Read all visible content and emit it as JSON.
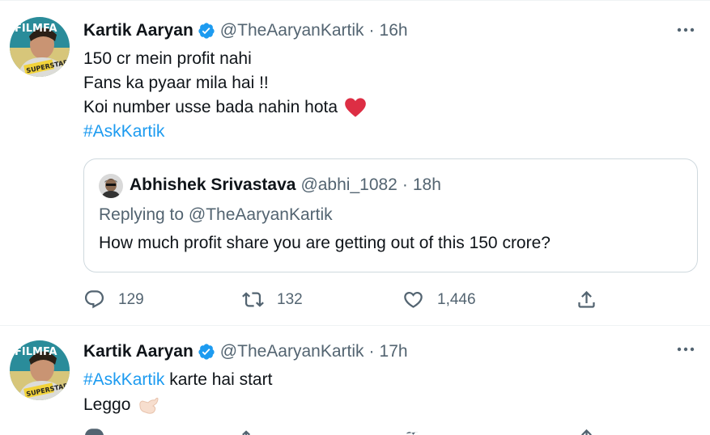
{
  "tweets": [
    {
      "name": "Kartik Aaryan",
      "handle": "@TheAaryanKartik",
      "time": "16h",
      "lines": [
        "150 cr mein profit nahi",
        "Fans ka pyaar mila hai !!",
        "Koi number usse bada nahin hota"
      ],
      "hashtag": "#AskKartik",
      "quote": {
        "name": "Abhishek Srivastava",
        "handle": "@abhi_1082",
        "time": "18h",
        "replying_label": "Replying to",
        "replying_to": "@TheAaryanKartik",
        "text": "How much profit share you are getting out of this 150 crore?"
      },
      "actions": {
        "replies": "129",
        "retweets": "132",
        "likes": "1,446"
      }
    },
    {
      "name": "Kartik Aaryan",
      "handle": "@TheAaryanKartik",
      "time": "17h",
      "hashtag": "#AskKartik",
      "line1_rest": " karte hai start",
      "line2": "Leggo"
    }
  ],
  "separator": "·",
  "icons": {
    "verified": "verified-badge-icon",
    "more": "more-options-icon",
    "reply": "reply-icon",
    "retweet": "retweet-icon",
    "like": "heart-icon",
    "share": "share-icon",
    "heart_emoji": "red-heart-emoji",
    "hand_emoji": "call-me-hand-emoji"
  },
  "colors": {
    "accent": "#1d9bf0",
    "secondary_text": "#536471",
    "heart": "#e0245e",
    "border": "#cfd9de"
  }
}
